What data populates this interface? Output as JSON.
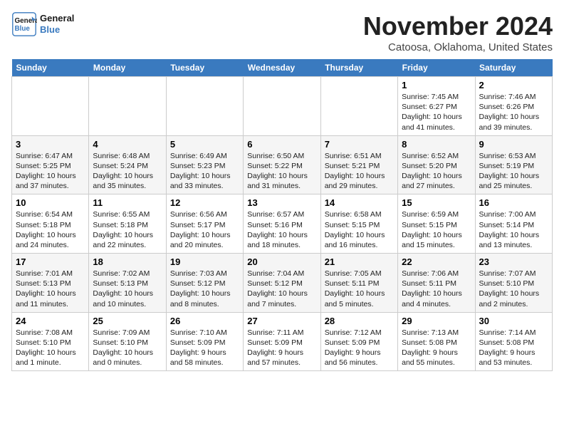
{
  "header": {
    "logo_line1": "General",
    "logo_line2": "Blue",
    "month": "November 2024",
    "location": "Catoosa, Oklahoma, United States"
  },
  "weekdays": [
    "Sunday",
    "Monday",
    "Tuesday",
    "Wednesday",
    "Thursday",
    "Friday",
    "Saturday"
  ],
  "weeks": [
    [
      {
        "day": "",
        "info": ""
      },
      {
        "day": "",
        "info": ""
      },
      {
        "day": "",
        "info": ""
      },
      {
        "day": "",
        "info": ""
      },
      {
        "day": "",
        "info": ""
      },
      {
        "day": "1",
        "info": "Sunrise: 7:45 AM\nSunset: 6:27 PM\nDaylight: 10 hours and 41 minutes."
      },
      {
        "day": "2",
        "info": "Sunrise: 7:46 AM\nSunset: 6:26 PM\nDaylight: 10 hours and 39 minutes."
      }
    ],
    [
      {
        "day": "3",
        "info": "Sunrise: 6:47 AM\nSunset: 5:25 PM\nDaylight: 10 hours and 37 minutes."
      },
      {
        "day": "4",
        "info": "Sunrise: 6:48 AM\nSunset: 5:24 PM\nDaylight: 10 hours and 35 minutes."
      },
      {
        "day": "5",
        "info": "Sunrise: 6:49 AM\nSunset: 5:23 PM\nDaylight: 10 hours and 33 minutes."
      },
      {
        "day": "6",
        "info": "Sunrise: 6:50 AM\nSunset: 5:22 PM\nDaylight: 10 hours and 31 minutes."
      },
      {
        "day": "7",
        "info": "Sunrise: 6:51 AM\nSunset: 5:21 PM\nDaylight: 10 hours and 29 minutes."
      },
      {
        "day": "8",
        "info": "Sunrise: 6:52 AM\nSunset: 5:20 PM\nDaylight: 10 hours and 27 minutes."
      },
      {
        "day": "9",
        "info": "Sunrise: 6:53 AM\nSunset: 5:19 PM\nDaylight: 10 hours and 25 minutes."
      }
    ],
    [
      {
        "day": "10",
        "info": "Sunrise: 6:54 AM\nSunset: 5:18 PM\nDaylight: 10 hours and 24 minutes."
      },
      {
        "day": "11",
        "info": "Sunrise: 6:55 AM\nSunset: 5:18 PM\nDaylight: 10 hours and 22 minutes."
      },
      {
        "day": "12",
        "info": "Sunrise: 6:56 AM\nSunset: 5:17 PM\nDaylight: 10 hours and 20 minutes."
      },
      {
        "day": "13",
        "info": "Sunrise: 6:57 AM\nSunset: 5:16 PM\nDaylight: 10 hours and 18 minutes."
      },
      {
        "day": "14",
        "info": "Sunrise: 6:58 AM\nSunset: 5:15 PM\nDaylight: 10 hours and 16 minutes."
      },
      {
        "day": "15",
        "info": "Sunrise: 6:59 AM\nSunset: 5:15 PM\nDaylight: 10 hours and 15 minutes."
      },
      {
        "day": "16",
        "info": "Sunrise: 7:00 AM\nSunset: 5:14 PM\nDaylight: 10 hours and 13 minutes."
      }
    ],
    [
      {
        "day": "17",
        "info": "Sunrise: 7:01 AM\nSunset: 5:13 PM\nDaylight: 10 hours and 11 minutes."
      },
      {
        "day": "18",
        "info": "Sunrise: 7:02 AM\nSunset: 5:13 PM\nDaylight: 10 hours and 10 minutes."
      },
      {
        "day": "19",
        "info": "Sunrise: 7:03 AM\nSunset: 5:12 PM\nDaylight: 10 hours and 8 minutes."
      },
      {
        "day": "20",
        "info": "Sunrise: 7:04 AM\nSunset: 5:12 PM\nDaylight: 10 hours and 7 minutes."
      },
      {
        "day": "21",
        "info": "Sunrise: 7:05 AM\nSunset: 5:11 PM\nDaylight: 10 hours and 5 minutes."
      },
      {
        "day": "22",
        "info": "Sunrise: 7:06 AM\nSunset: 5:11 PM\nDaylight: 10 hours and 4 minutes."
      },
      {
        "day": "23",
        "info": "Sunrise: 7:07 AM\nSunset: 5:10 PM\nDaylight: 10 hours and 2 minutes."
      }
    ],
    [
      {
        "day": "24",
        "info": "Sunrise: 7:08 AM\nSunset: 5:10 PM\nDaylight: 10 hours and 1 minute."
      },
      {
        "day": "25",
        "info": "Sunrise: 7:09 AM\nSunset: 5:10 PM\nDaylight: 10 hours and 0 minutes."
      },
      {
        "day": "26",
        "info": "Sunrise: 7:10 AM\nSunset: 5:09 PM\nDaylight: 9 hours and 58 minutes."
      },
      {
        "day": "27",
        "info": "Sunrise: 7:11 AM\nSunset: 5:09 PM\nDaylight: 9 hours and 57 minutes."
      },
      {
        "day": "28",
        "info": "Sunrise: 7:12 AM\nSunset: 5:09 PM\nDaylight: 9 hours and 56 minutes."
      },
      {
        "day": "29",
        "info": "Sunrise: 7:13 AM\nSunset: 5:08 PM\nDaylight: 9 hours and 55 minutes."
      },
      {
        "day": "30",
        "info": "Sunrise: 7:14 AM\nSunset: 5:08 PM\nDaylight: 9 hours and 53 minutes."
      }
    ]
  ]
}
